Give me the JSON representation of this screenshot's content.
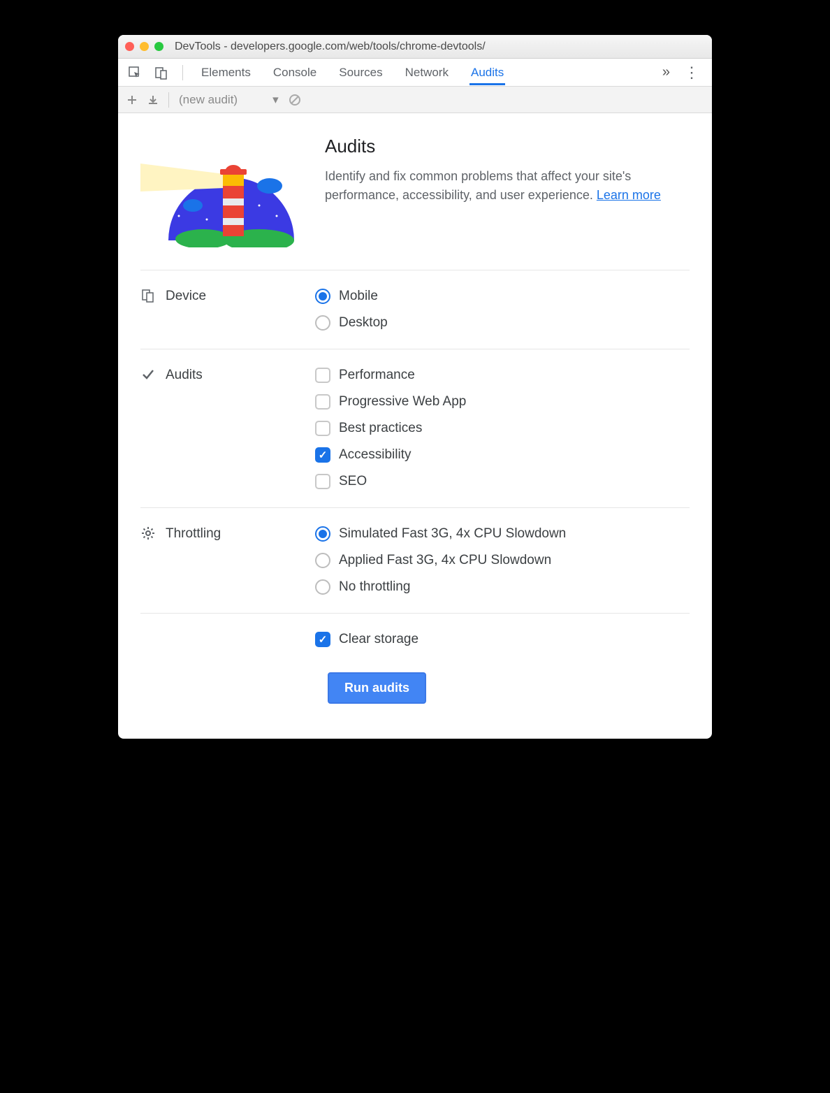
{
  "window": {
    "title": "DevTools - developers.google.com/web/tools/chrome-devtools/"
  },
  "tabs": {
    "items": [
      "Elements",
      "Console",
      "Sources",
      "Network",
      "Audits"
    ],
    "active": "Audits"
  },
  "toolbar": {
    "audit_dropdown": "(new audit)"
  },
  "intro": {
    "heading": "Audits",
    "description": "Identify and fix common problems that affect your site's performance, accessibility, and user experience. ",
    "learn_more": "Learn more"
  },
  "sections": {
    "device": {
      "label": "Device",
      "options": [
        "Mobile",
        "Desktop"
      ],
      "selected": "Mobile"
    },
    "audits": {
      "label": "Audits",
      "options": [
        {
          "label": "Performance",
          "checked": false
        },
        {
          "label": "Progressive Web App",
          "checked": false
        },
        {
          "label": "Best practices",
          "checked": false
        },
        {
          "label": "Accessibility",
          "checked": true
        },
        {
          "label": "SEO",
          "checked": false
        }
      ]
    },
    "throttling": {
      "label": "Throttling",
      "options": [
        "Simulated Fast 3G, 4x CPU Slowdown",
        "Applied Fast 3G, 4x CPU Slowdown",
        "No throttling"
      ],
      "selected": "Simulated Fast 3G, 4x CPU Slowdown"
    },
    "storage": {
      "clear_storage_label": "Clear storage",
      "clear_storage_checked": true
    }
  },
  "run_button": "Run audits"
}
